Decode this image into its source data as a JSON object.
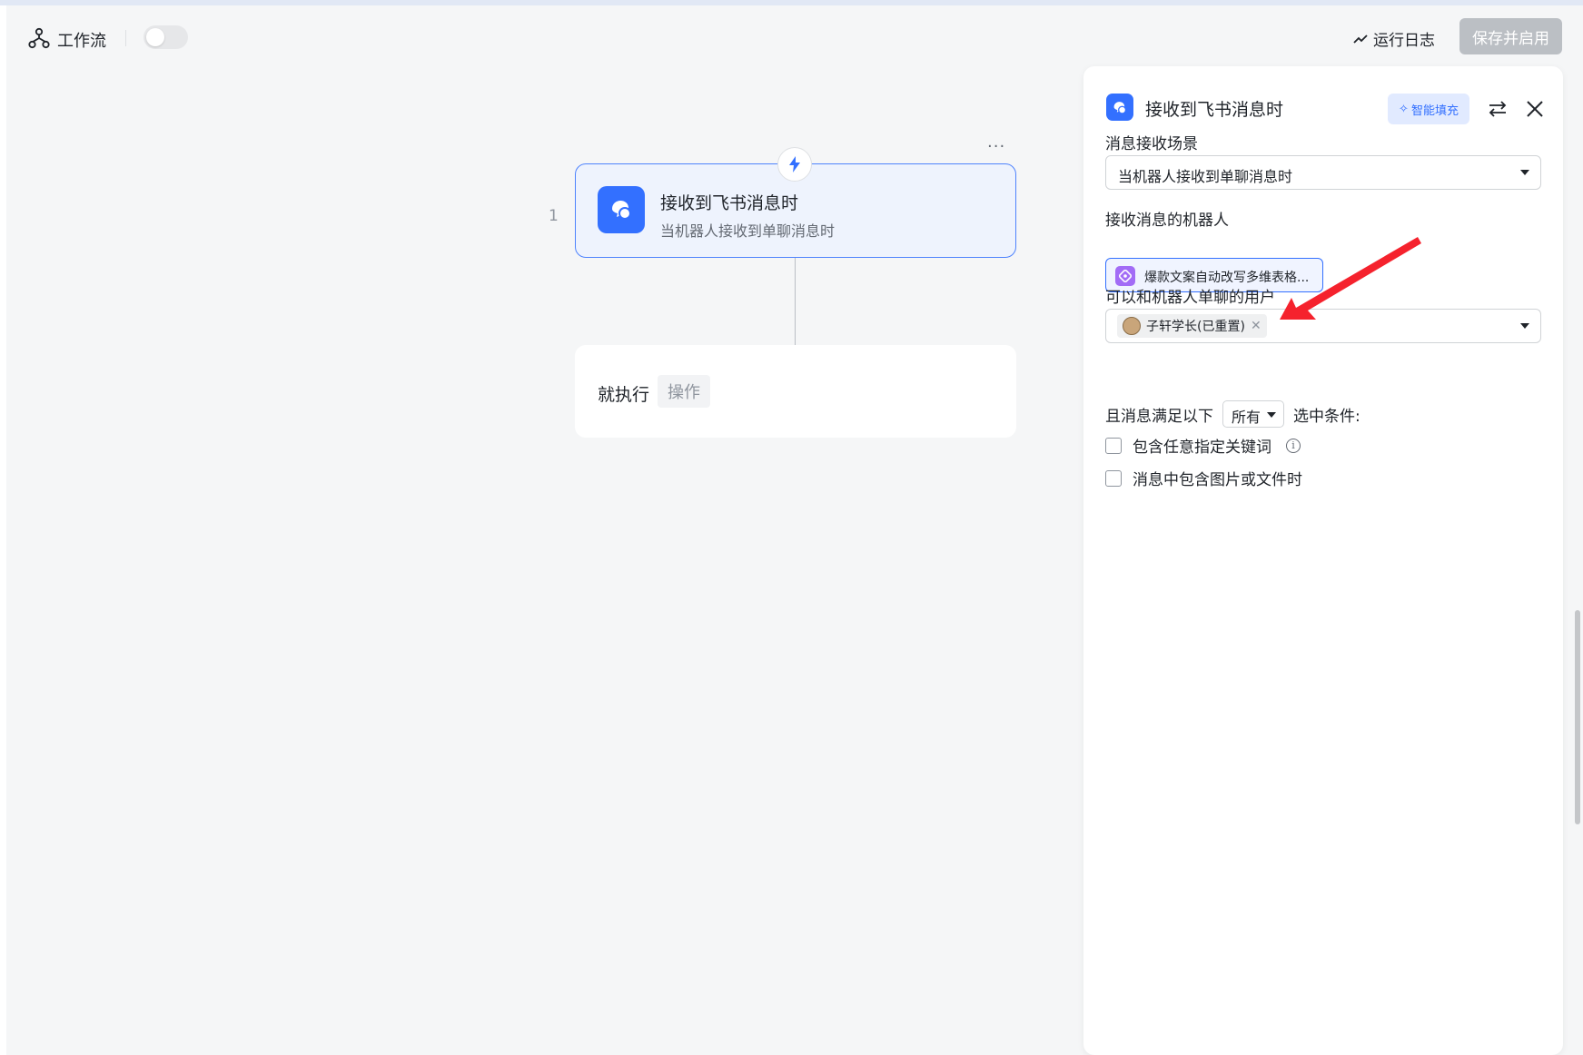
{
  "header": {
    "workflow_label": "工作流",
    "toggle_enabled": false,
    "run_log_label": "运行日志",
    "save_button_label": "保存并启用"
  },
  "canvas": {
    "more_label": "···",
    "step_number": "1",
    "trigger": {
      "title": "接收到飞书消息时",
      "subtitle": "当机器人接收到单聊消息时"
    },
    "action": {
      "label": "就执行",
      "placeholder_chip": "操作"
    }
  },
  "panel": {
    "title": "接收到飞书消息时",
    "ai_fill_label": "智能填充",
    "scene_label": "消息接收场景",
    "scene_value": "当机器人接收到单聊消息时",
    "bot_label": "接收消息的机器人",
    "bot_value": "爆款文案自动改写多维表格...",
    "users_label": "可以和机器人单聊的用户",
    "users": [
      {
        "name": "子轩学长(已重置)"
      }
    ],
    "condition": {
      "prefix": "且消息满足以下",
      "match_value": "所有",
      "suffix": "选中条件:"
    },
    "options": [
      {
        "label": "包含任意指定关键词",
        "checked": false,
        "has_info": true
      },
      {
        "label": "消息中包含图片或文件时",
        "checked": false,
        "has_info": false
      }
    ]
  },
  "colors": {
    "accent": "#3370ff",
    "annotation_arrow": "#f5222d",
    "bot_icon": "#a26cf6"
  }
}
